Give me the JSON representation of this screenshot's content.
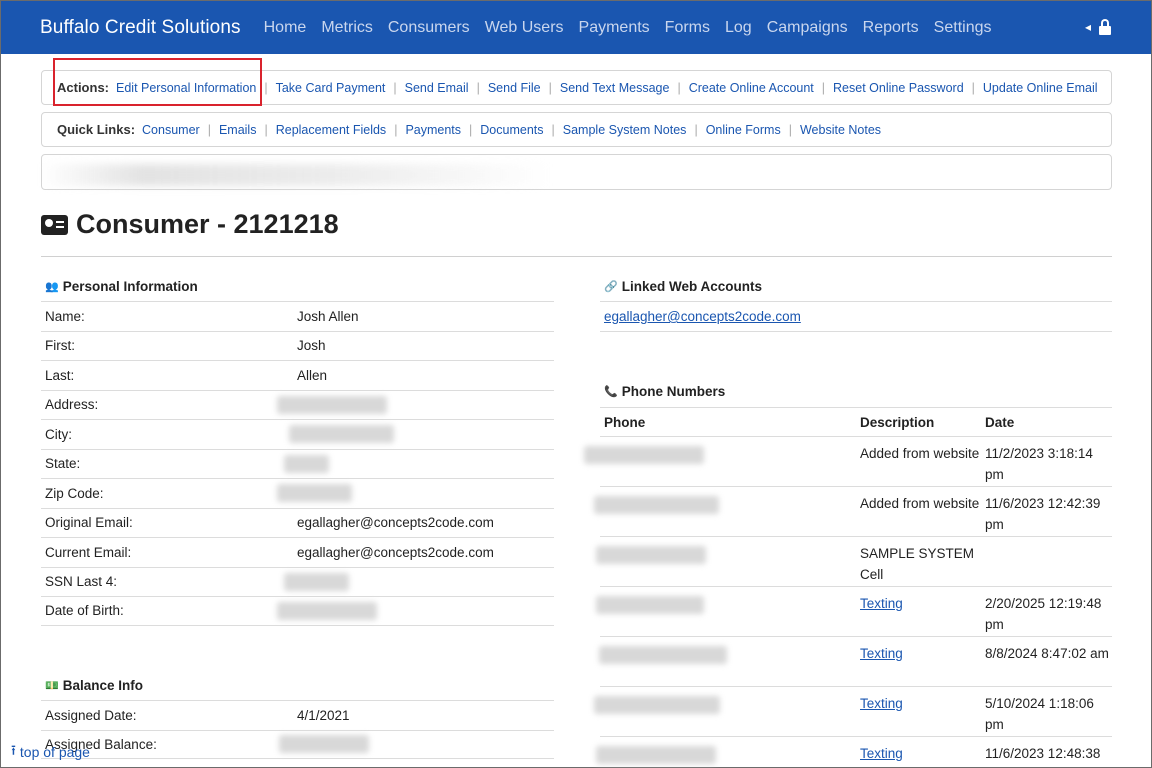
{
  "app": {
    "brand": "Buffalo Credit Solutions"
  },
  "nav": {
    "items": [
      "Home",
      "Metrics",
      "Consumers",
      "Web Users",
      "Payments",
      "Forms",
      "Log",
      "Campaigns",
      "Reports",
      "Settings"
    ],
    "chevron": "◂",
    "lock_icon": "lock-icon"
  },
  "actions": {
    "label": "Actions:",
    "items": [
      "Edit Personal Information",
      "Take Card Payment",
      "Send Email",
      "Send File",
      "Send Text Message",
      "Create Online Account",
      "Reset Online Password",
      "Update Online Email"
    ]
  },
  "quick_links": {
    "label": "Quick Links:",
    "items": [
      "Consumer",
      "Emails",
      "Replacement Fields",
      "Payments",
      "Documents",
      "Sample System Notes",
      "Online Forms",
      "Website Notes"
    ]
  },
  "page": {
    "title": "Consumer - 2121218"
  },
  "personal": {
    "heading": "Personal Information",
    "rows": [
      {
        "key": "Name:",
        "value": "Josh Allen"
      },
      {
        "key": "First:",
        "value": "Josh"
      },
      {
        "key": "Last:",
        "value": "Allen"
      },
      {
        "key": "Address:",
        "value": ""
      },
      {
        "key": "City:",
        "value": ""
      },
      {
        "key": "State:",
        "value": ""
      },
      {
        "key": "Zip Code:",
        "value": ""
      },
      {
        "key": "Original Email:",
        "value": "egallagher@concepts2code.com"
      },
      {
        "key": "Current Email:",
        "value": "egallagher@concepts2code.com"
      },
      {
        "key": "SSN Last 4:",
        "value": ""
      },
      {
        "key": "Date of Birth:",
        "value": ""
      }
    ]
  },
  "balance": {
    "heading": "Balance Info",
    "rows": [
      {
        "key": "Assigned Date:",
        "value": "4/1/2021"
      },
      {
        "key": "Assigned Balance:",
        "value": ""
      }
    ]
  },
  "linked": {
    "heading": "Linked Web Accounts",
    "account": "egallagher@concepts2code.com"
  },
  "phones": {
    "heading": "Phone Numbers",
    "columns": [
      "Phone",
      "Description",
      "Date"
    ],
    "rows": [
      {
        "desc": "Added from website",
        "date": "11/2/2023 3:18:14 pm",
        "link": false
      },
      {
        "desc": "Added from website",
        "date": "11/6/2023 12:42:39 pm",
        "link": false
      },
      {
        "desc": "SAMPLE SYSTEM Cell",
        "date": "",
        "link": false
      },
      {
        "desc": "Texting",
        "date": "2/20/2025 12:19:48 pm",
        "link": true
      },
      {
        "desc": "Texting",
        "date": "8/8/2024 8:47:02 am",
        "link": true
      },
      {
        "desc": "Texting",
        "date": "5/10/2024 1:18:06 pm",
        "link": true
      },
      {
        "desc": "Texting",
        "date": "11/6/2023 12:48:38",
        "link": true
      }
    ]
  },
  "footer": {
    "top_link": "top of page"
  }
}
